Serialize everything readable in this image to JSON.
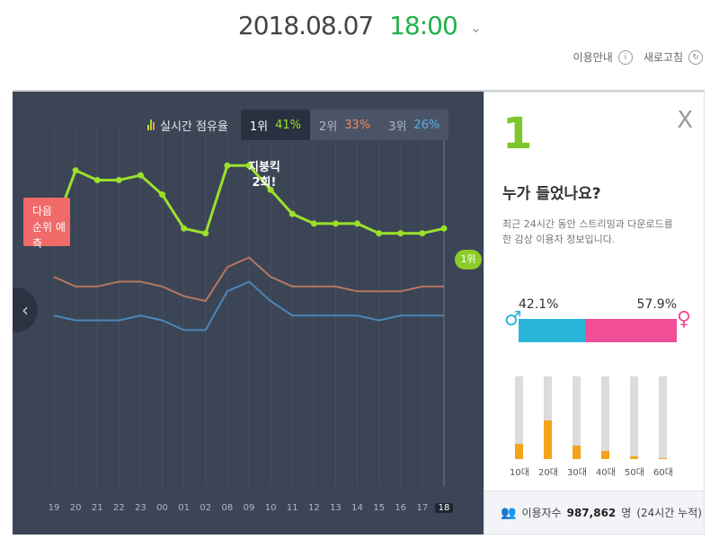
{
  "header": {
    "date": "2018.08.07",
    "time": "18:00",
    "chevron_icon": "chevron-down-icon"
  },
  "util": {
    "guide": "이용안내",
    "guide_icon": "info-icon",
    "refresh": "새로고침",
    "refresh_icon": "refresh-icon"
  },
  "legend": {
    "title": "실시간 점유율",
    "ranks": [
      {
        "label": "1위",
        "pct": "41%",
        "color": "#9be02b"
      },
      {
        "label": "2위",
        "pct": "33%",
        "color": "#f08a5d"
      },
      {
        "label": "3위",
        "pct": "26%",
        "color": "#54aee6"
      }
    ]
  },
  "predict": {
    "line1": "다음",
    "line2": "순위 예측"
  },
  "bubble": {
    "line1": "지붕킥",
    "line2": "2회!"
  },
  "rank_end": "1위",
  "chart_data": {
    "type": "line",
    "x": [
      "19",
      "20",
      "21",
      "22",
      "23",
      "00",
      "01",
      "02",
      "08",
      "09",
      "10",
      "11",
      "12",
      "13",
      "14",
      "15",
      "16",
      "17",
      "18"
    ],
    "series": [
      {
        "name": "1위",
        "color": "#9be02b",
        "values": [
          46,
          58,
          56,
          56,
          57,
          53,
          46,
          45,
          59,
          59,
          54,
          49,
          47,
          47,
          47,
          45,
          45,
          45,
          46
        ]
      },
      {
        "name": "2위",
        "color": "#b8775f",
        "values": [
          36,
          34,
          34,
          35,
          35,
          34,
          32,
          31,
          38,
          40,
          36,
          34,
          34,
          34,
          33,
          33,
          33,
          34,
          34
        ]
      },
      {
        "name": "3위",
        "color": "#4d86b8",
        "values": [
          28,
          27,
          27,
          27,
          28,
          27,
          25,
          25,
          33,
          35,
          31,
          28,
          28,
          28,
          28,
          27,
          28,
          28,
          28
        ]
      }
    ],
    "ylim": [
      0,
      65
    ],
    "current_x": "18"
  },
  "panel": {
    "rank": "1",
    "close_label": "X",
    "question": "누가 들었나요?",
    "desc": "최근 24시간 동안 스트리밍과 다운로드를 한 감상 이용자 정보입니다.",
    "male_pct": "42.1%",
    "female_pct": "57.9%",
    "male_value": 42.1,
    "female_value": 57.9,
    "ages": [
      {
        "label": "10대",
        "value": 0.18
      },
      {
        "label": "20대",
        "value": 0.47
      },
      {
        "label": "30대",
        "value": 0.16
      },
      {
        "label": "40대",
        "value": 0.1
      },
      {
        "label": "50대",
        "value": 0.03
      },
      {
        "label": "60대",
        "value": 0.01
      }
    ],
    "footer": {
      "label": "이용자수",
      "count": "987,862",
      "unit": "명",
      "note": "(24시간 누적)"
    }
  }
}
